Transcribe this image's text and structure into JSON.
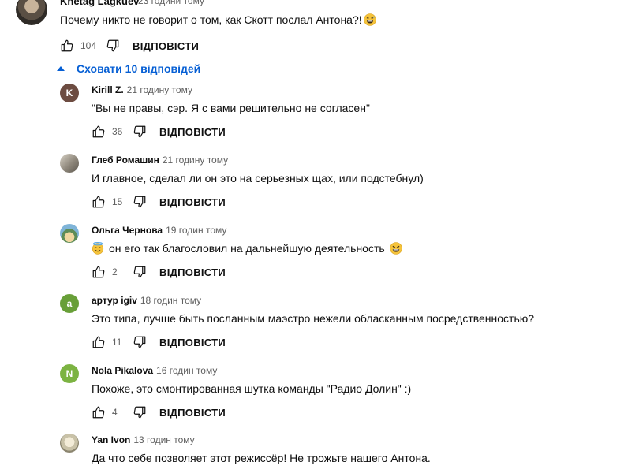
{
  "top_comment": {
    "author": "Knetag Lagkuev",
    "time": "23 години тому",
    "text": "Почему никто не говорит о том, как Скотт послал Антона?!",
    "likes": "104",
    "reply_label": "ВІДПОВІСТИ"
  },
  "toggle": {
    "label": "Сховати 10 відповідей"
  },
  "replies": [
    {
      "author": "Kirill Z.",
      "time": "21 годину тому",
      "text": "\"Вы не правы, сэр. Я с вами решительно не согласен\"",
      "likes": "36",
      "reply_label": "ВІДПОВІСТИ",
      "avatar_letter": "K",
      "avatar_color": "#6d4c41"
    },
    {
      "author": "Глеб Ромашин",
      "time": "21 годину тому",
      "text": "И главное, сделал ли он это на серьезных щах, или подстебнул)",
      "likes": "15",
      "reply_label": "ВІДПОВІСТИ",
      "avatar_letter": "",
      "avatar_color": "#9e9a94"
    },
    {
      "author": "Ольга Чернова",
      "time": "19 годин тому",
      "text_after": "он его так благословил на дальнейшую деятельность",
      "likes": "2",
      "reply_label": "ВІДПОВІСТИ",
      "avatar_letter": "",
      "avatar_color": "#6fa3c9"
    },
    {
      "author": "артур igiv",
      "time": "18 годин тому",
      "text": "Это типа, лучше быть посланным маэстро нежели обласканным посредственностью?",
      "likes": "11",
      "reply_label": "ВІДПОВІСТИ",
      "avatar_letter": "a",
      "avatar_color": "#689f38"
    },
    {
      "author": "Nola Pikalova",
      "time": "16 годин тому",
      "text": "Похоже, это смонтированная шутка команды \"Радио Долин\" :)",
      "likes": "4",
      "reply_label": "ВІДПОВІСТИ",
      "avatar_letter": "N",
      "avatar_color": "#7cb342"
    },
    {
      "author": "Yan Ivon",
      "time": "13 годин тому",
      "text": "Да что себе позволяет этот режиссёр! Не трожьте нашего Антона.",
      "likes": "",
      "reply_label": "ВІДПОВІСТИ",
      "avatar_letter": "",
      "avatar_color": "#c9c2a8"
    }
  ],
  "icons": {
    "like": "thumbs-up-icon",
    "dislike": "thumbs-down-icon",
    "toggle": "caret-up-icon",
    "emoji_sweat": "grinning-sweat-emoji",
    "emoji_halo": "smiling-halo-emoji",
    "emoji_grin": "grinning-squinting-emoji"
  },
  "colors": {
    "link": "#065fd4",
    "secondary_text": "#606060",
    "primary_text": "#0f0f0f"
  }
}
